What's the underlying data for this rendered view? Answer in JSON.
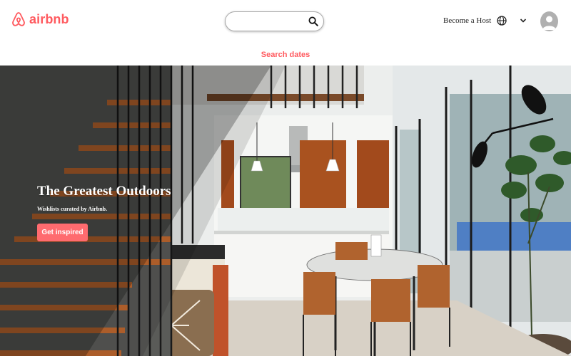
{
  "brand": {
    "name": "airbnb",
    "color": "#ff5a5f",
    "logo_icon": "airbnb-belo-icon"
  },
  "header": {
    "search": {
      "value": "",
      "placeholder": "",
      "button_icon": "search-icon"
    },
    "become_host_label": "Become a Host",
    "language_icon": "globe-icon",
    "menu_icon": "chevron-down-icon",
    "profile_icon": "user-avatar-icon"
  },
  "search_dates_label": "Search dates",
  "hero": {
    "title": "The Greatest Outdoors",
    "subtitle": "Wishlists curated by Airbnb.",
    "cta_label": "Get inspired",
    "cta_color": "#ff6b6f",
    "image_description": "modern home interior with staircase, kitchen and dining table"
  }
}
